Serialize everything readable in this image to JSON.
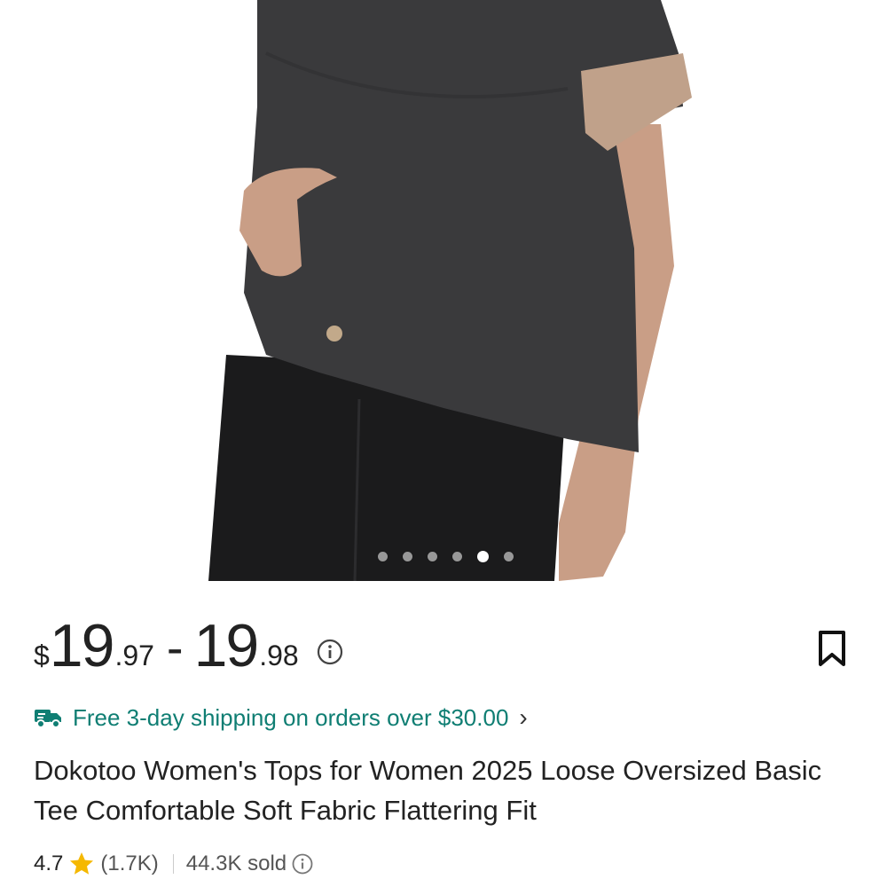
{
  "product": {
    "image_alt": "Woman wearing a dark gray oversized tee with beige cuffs and black jeans",
    "gallery": {
      "total": 6,
      "active_index": 4
    }
  },
  "price": {
    "currency": "$",
    "low_whole": "19",
    "low_cents": ".97",
    "separator": "-",
    "high_whole": "19",
    "high_cents": ".98"
  },
  "shipping": {
    "text": "Free 3-day shipping on orders over $30.00",
    "chevron": "›",
    "color": "#0f7e73"
  },
  "title": "Dokotoo Women's Tops for Women 2025 Loose Oversized Basic Tee Comfortable Soft Fabric Flattering Fit",
  "rating": {
    "score": "4.7",
    "count": "(1.7K)",
    "sold": "44.3K sold",
    "star_color": "#f5b800"
  },
  "icons": {
    "price_info": "info-icon",
    "bookmark": "bookmark-icon",
    "truck": "truck-icon",
    "star": "star-icon",
    "sold_info": "info-icon"
  }
}
